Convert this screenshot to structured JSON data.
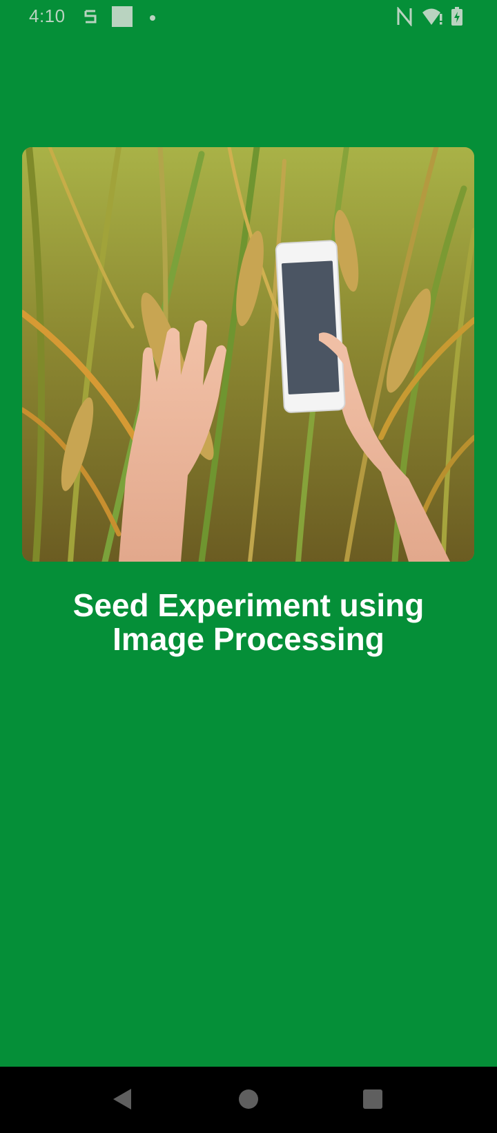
{
  "status_bar": {
    "time": "4:10",
    "icons": [
      "sync-icon",
      "square-notification-icon",
      "dot-icon",
      "nfc-icon",
      "wifi-alert-icon",
      "battery-charging-icon"
    ],
    "icon_color": "#b9d3c0"
  },
  "hero": {
    "image": "hands-holding-phone-in-rice-field",
    "alt": ""
  },
  "main": {
    "title_line1": "Seed Experiment using",
    "title_line2": "Image Processing"
  },
  "nav_bar": {
    "buttons": [
      "back-icon",
      "home-icon",
      "recents-icon"
    ]
  },
  "colors": {
    "background": "#058f38",
    "title": "#ffffff",
    "nav_bar": "#000000"
  }
}
